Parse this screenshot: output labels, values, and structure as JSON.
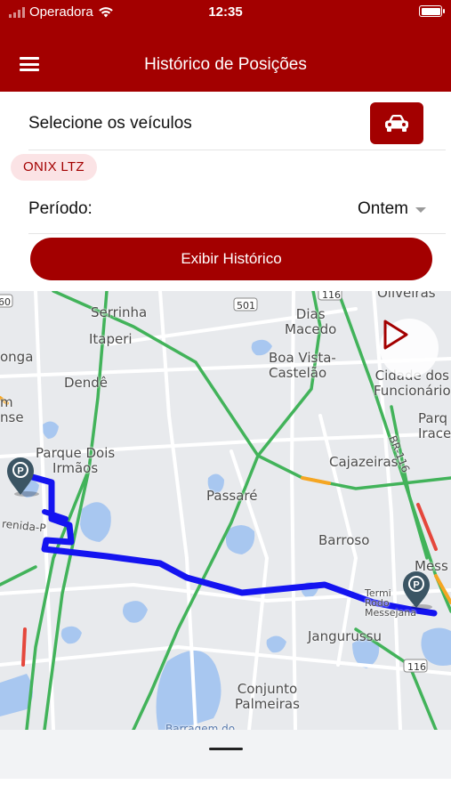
{
  "status_bar": {
    "carrier": "Operadora",
    "time": "12:35"
  },
  "header": {
    "title": "Histórico de Posições",
    "menu_icon": "hamburger-menu-icon"
  },
  "vehicles": {
    "label": "Selecione os veículos",
    "button_icon": "car-icon",
    "selected": [
      "ONIX LTZ"
    ]
  },
  "period": {
    "label": "Período:",
    "value": "Ontem"
  },
  "actions": {
    "show_history": "Exibir Histórico"
  },
  "map": {
    "labels": {
      "oliveiras": "Oliveiras",
      "serrinha": "Serrinha",
      "dias_macedo": "Dias\nMacedo",
      "itaperi": "Itaperi",
      "onga": "onga",
      "boa_vista": "Boa Vista-\nCastelão",
      "cidade_func": "Cidade dos\nFuncionário",
      "dende": "Dendê",
      "m_nse": "m\nnse",
      "parque_iracema": "Parq\nIrace",
      "parque_dois_irmaos": "Parque Dois\nIrmãos",
      "cajazeiras": "Cajazeiras",
      "passare": "Passaré",
      "barroso": "Barroso",
      "messejana_short": "Mess",
      "terminal": "Termi\nRodo\nMessejana",
      "jangurussu": "Jangurussu",
      "conjunto_palmeiras": "Conjunto\nPalmeiras",
      "avenida": "renida-P",
      "barragem": "Barragem do",
      "br116": "BR-116",
      "road_501": "501",
      "road_116a": "116",
      "road_116b": "116",
      "road_60": "60"
    },
    "play_icon": "play-icon",
    "start_marker_icon": "parking-pin-icon",
    "end_marker_icon": "parking-pin-icon",
    "route_color": "#1414f0",
    "accent_color": "#a30000"
  }
}
